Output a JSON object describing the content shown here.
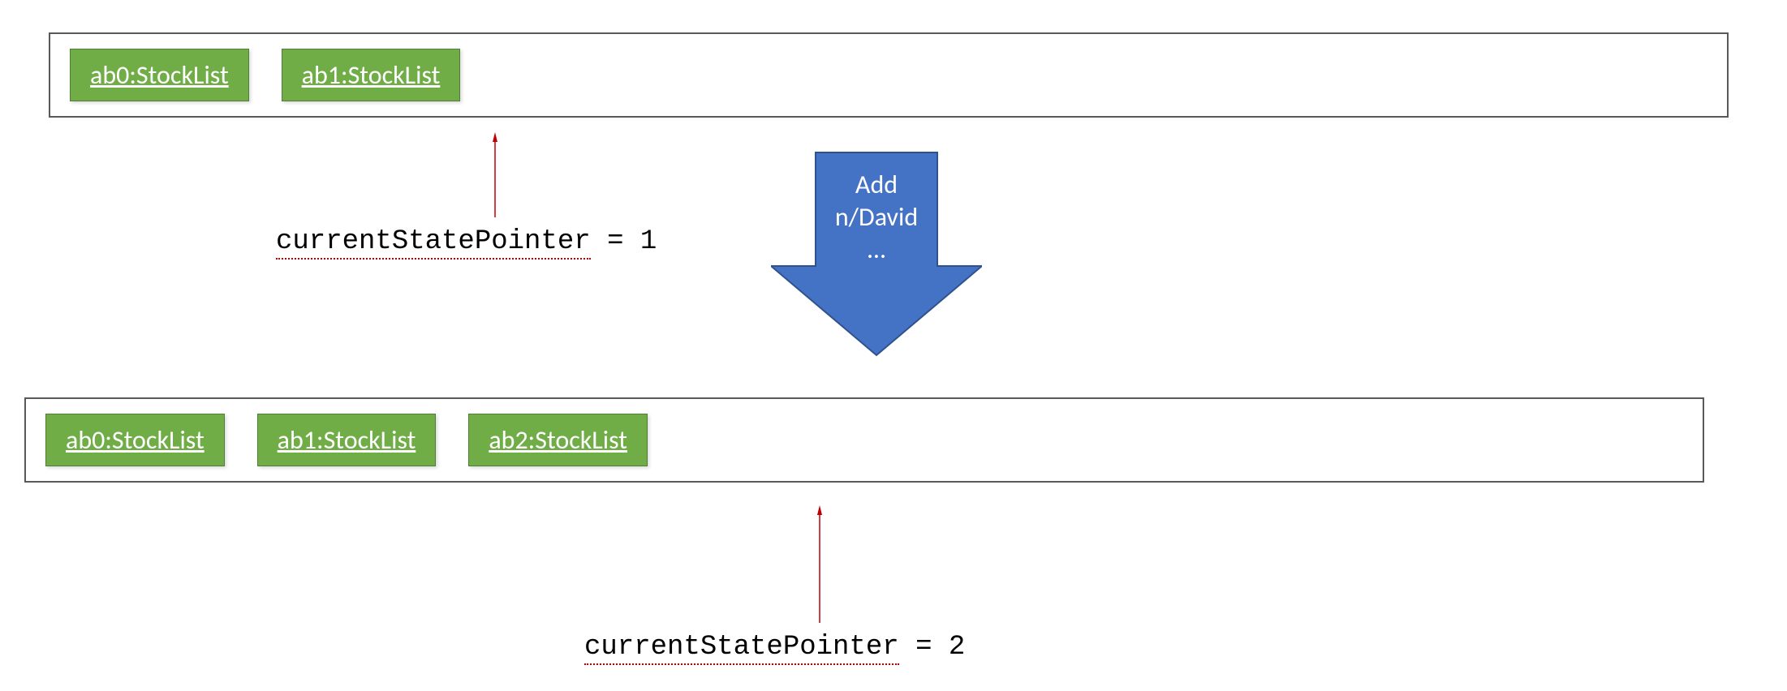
{
  "state1": {
    "boxes": [
      "ab0:StockList",
      "ab1:StockList"
    ],
    "pointer_var": "currentStatePointer",
    "pointer_eq": " = ",
    "pointer_val": "1"
  },
  "command_arrow": {
    "line1": "Add",
    "line2": "n/David",
    "line3": "…"
  },
  "state2": {
    "boxes": [
      "ab0:StockList",
      "ab1:StockList",
      "ab2:StockList"
    ],
    "pointer_var": "currentStatePointer",
    "pointer_eq": " = ",
    "pointer_val": "2"
  }
}
